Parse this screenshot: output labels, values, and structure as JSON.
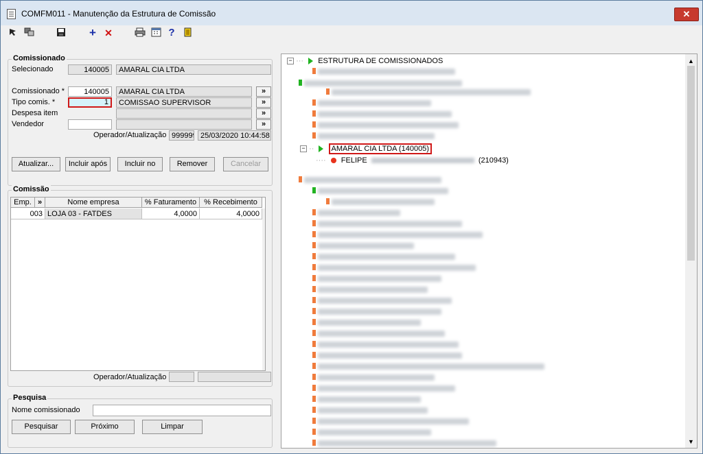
{
  "window": {
    "title": "COMFM011 - Manutenção da Estrutura de Comissão",
    "close_label": "✕"
  },
  "toolbar": {
    "add_label": "+",
    "delete_label": "✕",
    "help_label": "?"
  },
  "comissionado": {
    "legend": "Comissionado",
    "selecionado_label": "Selecionado",
    "selecionado_code": "140005",
    "selecionado_name": "AMARAL CIA LTDA",
    "comissionado_label": "Comissionado *",
    "comissionado_code": "140005",
    "comissionado_name": "AMARAL CIA LTDA",
    "tipo_label": "Tipo comis. *",
    "tipo_code": "1",
    "tipo_name": "COMISSAO SUPERVISOR",
    "despesa_label": "Despesa item",
    "vendedor_label": "Vendedor",
    "operador_label": "Operador/Atualização",
    "operador_value": "999999",
    "atualizacao_value": "25/03/2020 10:44:58",
    "lookup_label": "»"
  },
  "actions": {
    "atualizar": "Atualizar...",
    "incluir_apos": "Incluir após",
    "incluir_no": "Incluir no",
    "remover": "Remover",
    "cancelar": "Cancelar"
  },
  "comissao": {
    "legend": "Comissão",
    "columns": [
      "Emp.",
      "»",
      "Nome empresa",
      "% Faturamento",
      "% Recebimento"
    ],
    "rows": [
      {
        "emp": "003",
        "nome": "LOJA 03 - FATDES",
        "faturamento": "4,0000",
        "recebimento": "4,0000"
      }
    ],
    "operador_label": "Operador/Atualização"
  },
  "pesquisa": {
    "legend": "Pesquisa",
    "nome_label": "Nome comissionado",
    "nome_value": "",
    "pesquisar": "Pesquisar",
    "proximo": "Próximo",
    "limpar": "Limpar"
  },
  "tree": {
    "root_label": "ESTRUTURA DE COMISSIONADOS",
    "selected_node": "AMARAL CIA LTDA (140005)",
    "child_name": "FELIPE",
    "child_code": "(210943)",
    "colors": {
      "orange": "#f07b3c",
      "green": "#21b321",
      "selected_border": "#d01818"
    }
  }
}
